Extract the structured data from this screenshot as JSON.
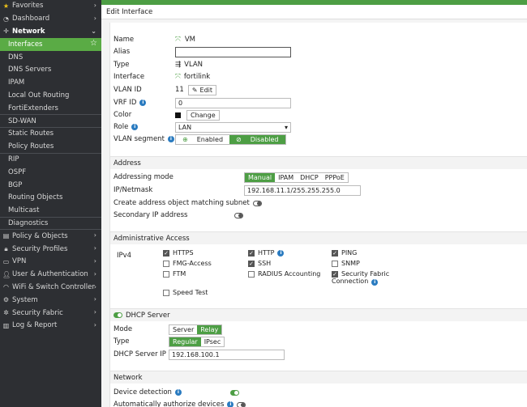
{
  "sidebar": {
    "items": [
      {
        "label": "Favorites",
        "icon": "star-icon",
        "chev": "›"
      },
      {
        "label": "Dashboard",
        "icon": "dashboard-icon",
        "chev": "›"
      },
      {
        "label": "Network",
        "icon": "network-icon",
        "chev": "⌄"
      },
      {
        "label": "Interfaces"
      },
      {
        "label": "DNS"
      },
      {
        "label": "DNS Servers"
      },
      {
        "label": "IPAM"
      },
      {
        "label": "Local Out Routing"
      },
      {
        "label": "FortiExtenders"
      },
      {
        "label": "SD-WAN"
      },
      {
        "label": "Static Routes"
      },
      {
        "label": "Policy Routes"
      },
      {
        "label": "RIP"
      },
      {
        "label": "OSPF"
      },
      {
        "label": "BGP"
      },
      {
        "label": "Routing Objects"
      },
      {
        "label": "Multicast"
      },
      {
        "label": "Diagnostics"
      },
      {
        "label": "Policy & Objects",
        "icon": "policy-icon",
        "chev": "›"
      },
      {
        "label": "Security Profiles",
        "icon": "lock-icon",
        "chev": "›"
      },
      {
        "label": "VPN",
        "icon": "monitor-icon",
        "chev": "›"
      },
      {
        "label": "User & Authentication",
        "icon": "user-icon",
        "chev": "›"
      },
      {
        "label": "WiFi & Switch Controller",
        "icon": "wifi-icon",
        "chev": "›"
      },
      {
        "label": "System",
        "icon": "gear-icon",
        "chev": "›"
      },
      {
        "label": "Security Fabric",
        "icon": "fabric-icon",
        "chev": "›"
      },
      {
        "label": "Log & Report",
        "icon": "report-icon",
        "chev": "›"
      }
    ]
  },
  "header": {
    "title": "Edit Interface"
  },
  "form": {
    "name_label": "Name",
    "name_value": "VM",
    "alias_label": "Alias",
    "alias_value": "",
    "type_label": "Type",
    "type_value": "VLAN",
    "interface_label": "Interface",
    "interface_value": "fortilink",
    "vlan_id_label": "VLAN ID",
    "vlan_id_value": "11",
    "edit_label": "Edit",
    "vrf_id_label": "VRF ID",
    "vrf_id_value": "0",
    "color_label": "Color",
    "change_label": "Change",
    "role_label": "Role",
    "role_value": "LAN",
    "vlan_segment_label": "VLAN segment",
    "enabled_label": "Enabled",
    "disabled_label": "Disabled"
  },
  "address": {
    "section_title": "Address",
    "mode_label": "Addressing mode",
    "modes": [
      "Manual",
      "IPAM",
      "DHCP",
      "PPPoE"
    ],
    "ipmask_label": "IP/Netmask",
    "ipmask_value": "192.168.11.1/255.255.255.0",
    "create_obj_label": "Create address object matching subnet",
    "secondary_label": "Secondary IP address"
  },
  "admin": {
    "section_title": "Administrative Access",
    "ipv4_label": "IPv4",
    "https": "HTTPS",
    "http": "HTTP",
    "ping": "PING",
    "fmg": "FMG-Access",
    "ssh": "SSH",
    "snmp": "SNMP",
    "ftm": "FTM",
    "radius": "RADIUS Accounting",
    "fabric_1": "Security Fabric",
    "fabric_2": "Connection",
    "speed": "Speed Test"
  },
  "dhcp": {
    "section_title": "DHCP Server",
    "mode_label": "Mode",
    "server": "Server",
    "relay": "Relay",
    "type_label": "Type",
    "regular": "Regular",
    "ipsec": "IPsec",
    "ip_label": "DHCP Server IP",
    "ip_value": "192.168.100.1"
  },
  "network": {
    "section_title": "Network",
    "device_detection": "Device detection",
    "auto_authorize": "Automatically authorize devices"
  },
  "colors": {
    "accent": "#4d9e44",
    "sidebar": "#2d2f33",
    "info": "#2a7bc0"
  }
}
